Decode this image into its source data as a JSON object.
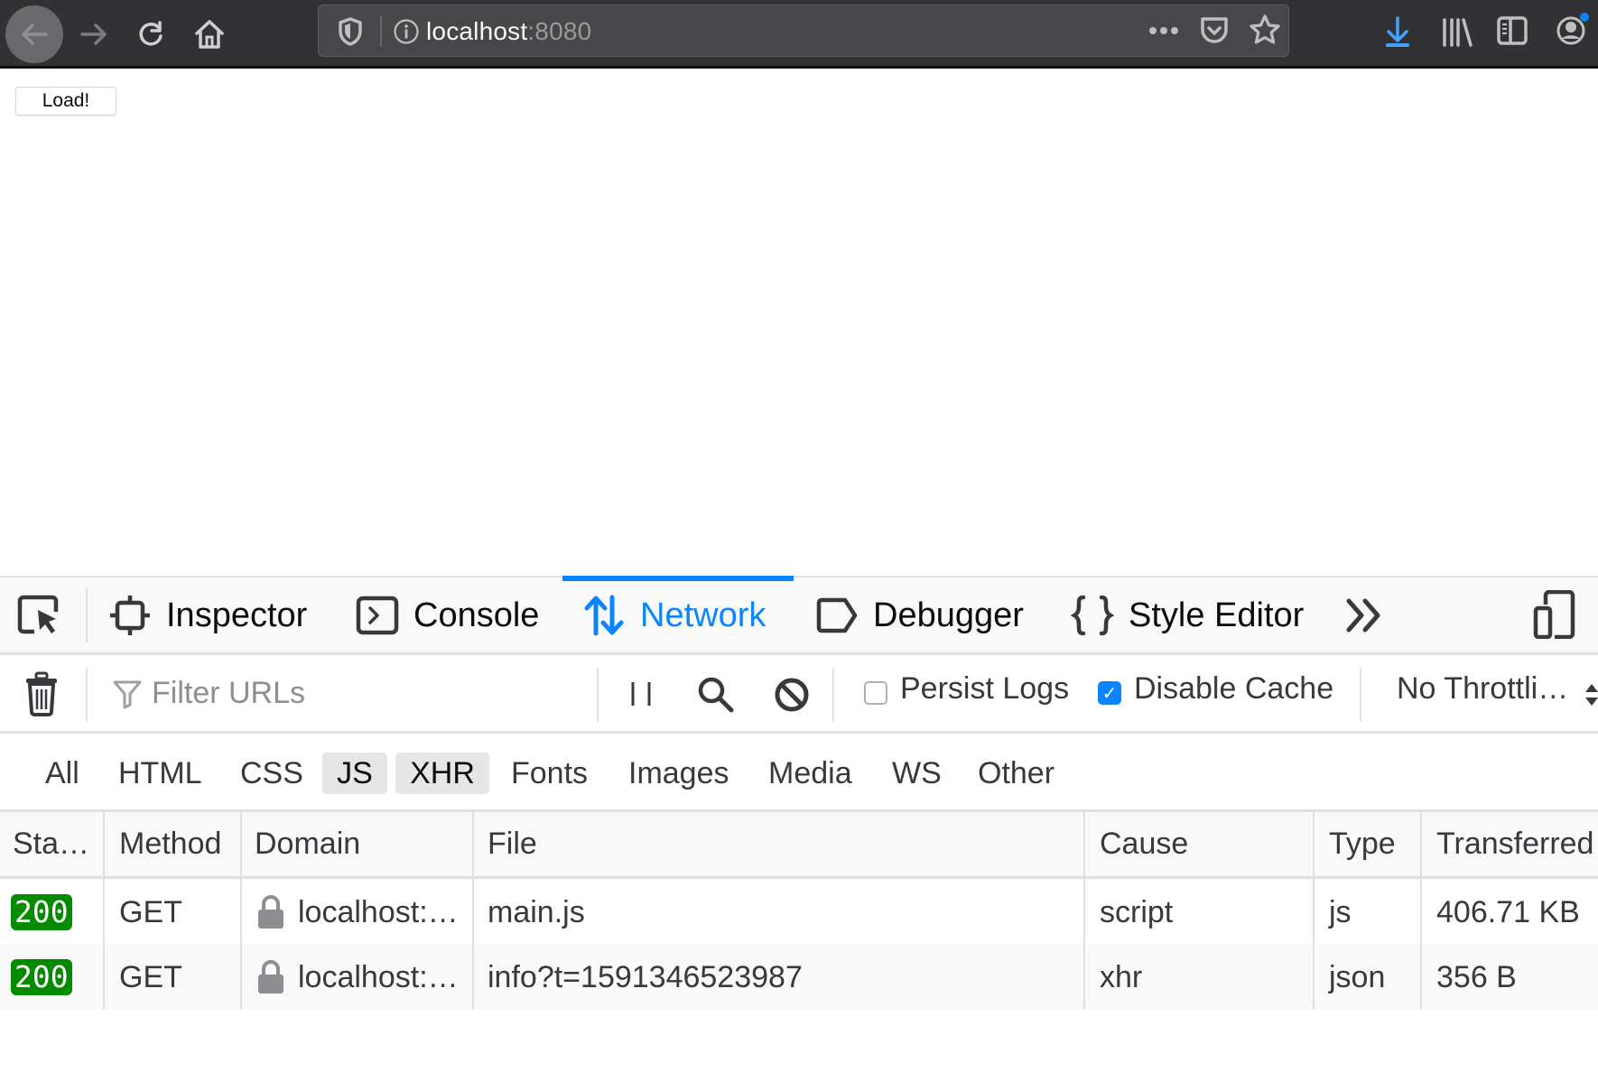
{
  "browser": {
    "url_host": "localhost",
    "url_port": ":8080",
    "icons": [
      "back-icon",
      "forward-icon",
      "reload-icon",
      "home-icon",
      "tracking-protection-shield-icon",
      "site-info-icon",
      "page-actions-ellipsis-icon",
      "pocket-icon",
      "bookmark-star-icon",
      "downloads-icon",
      "library-icon",
      "sidebar-icon",
      "account-icon"
    ],
    "colors": {
      "toolbar": "#323234",
      "urlbar": "#474749",
      "downloads_accent": "#45a1ff",
      "account_badge": "#0a84ff"
    }
  },
  "page": {
    "load_button_label": "Load!"
  },
  "devtools": {
    "tabs": [
      {
        "label": "Inspector",
        "icon": "inspector-icon",
        "selected": false
      },
      {
        "label": "Console",
        "icon": "console-icon",
        "selected": false
      },
      {
        "label": "Network",
        "icon": "network-arrows-icon",
        "selected": true
      },
      {
        "label": "Debugger",
        "icon": "debugger-icon",
        "selected": false
      },
      {
        "label": "Style Editor",
        "icon": "braces-icon",
        "selected": false
      }
    ],
    "accent_color": "#0a84ff",
    "toolbar": {
      "filter_placeholder": "Filter URLs",
      "persist_logs_label": "Persist Logs",
      "persist_logs_checked": false,
      "disable_cache_label": "Disable Cache",
      "disable_cache_checked": true,
      "throttling_value": "No Throttli…"
    },
    "type_filters": [
      {
        "label": "All",
        "checked": false
      },
      {
        "label": "HTML",
        "checked": false
      },
      {
        "label": "CSS",
        "checked": false
      },
      {
        "label": "JS",
        "checked": true
      },
      {
        "label": "XHR",
        "checked": true
      },
      {
        "label": "Fonts",
        "checked": false
      },
      {
        "label": "Images",
        "checked": false
      },
      {
        "label": "Media",
        "checked": false
      },
      {
        "label": "WS",
        "checked": false
      },
      {
        "label": "Other",
        "checked": false
      }
    ],
    "columns": [
      "Sta…",
      "Method",
      "Domain",
      "File",
      "Cause",
      "Type",
      "Transferred"
    ],
    "requests": [
      {
        "status": "200",
        "method": "GET",
        "domain": "localhost:…",
        "file": "main.js",
        "cause": "script",
        "type": "js",
        "transferred": "406.71 KB"
      },
      {
        "status": "200",
        "method": "GET",
        "domain": "localhost:…",
        "file": "info?t=1591346523987",
        "cause": "xhr",
        "type": "json",
        "transferred": "356 B"
      }
    ],
    "status_color": "#058b00"
  }
}
